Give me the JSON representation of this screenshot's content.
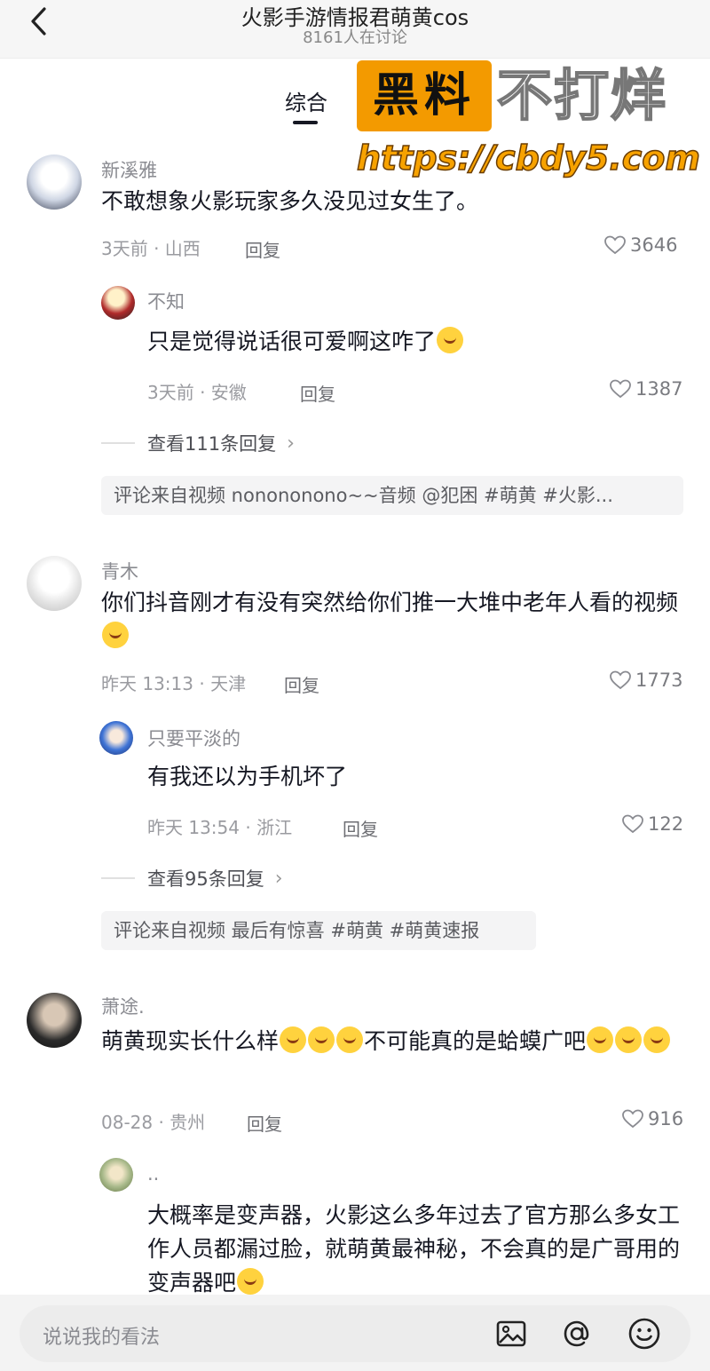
{
  "header": {
    "title": "火影手游情报君萌黄cos",
    "subtitle": "8161人在讨论"
  },
  "tab": {
    "label": "综合"
  },
  "watermark": {
    "box_text": "黑料",
    "text": "不打烊",
    "url": "https://cbdy5.com"
  },
  "comments": [
    {
      "name": "新溪雅",
      "text": "不敢想象火影玩家多久没见过女生了。",
      "meta": "3天前 · 山西",
      "reply_label": "回复",
      "likes": "3646",
      "sub": {
        "name": "不知",
        "text": "只是觉得说话很可爱啊这咋了",
        "meta": "3天前 · 安徽",
        "reply_label": "回复",
        "likes": "1387"
      },
      "more": "查看111条回复",
      "source": "评论来自视频 nonononono~~音频 @犯困 #萌黄 #火影..."
    },
    {
      "name": "青木",
      "text": "你们抖音刚才有没有突然给你们推一大堆中老年人看的视频",
      "meta": "昨天 13:13 · 天津",
      "reply_label": "回复",
      "likes": "1773",
      "sub": {
        "name": "只要平淡的",
        "text": "有我还以为手机坏了",
        "meta": "昨天 13:54 · 浙江",
        "reply_label": "回复",
        "likes": "122"
      },
      "more": "查看95条回复",
      "source": "评论来自视频 最后有惊喜 #萌黄 #萌黄速报"
    },
    {
      "name": "萧途.",
      "text_a": "萌黄现实长什么样",
      "text_b": "不可能真的是蛤蟆广吧",
      "meta": "08-28 · 贵州",
      "reply_label": "回复",
      "likes": "916",
      "sub": {
        "name": "..",
        "text": "大概率是变声器，火影这么多年过去了官方那么多女工作人员都漏过脸，就萌黄最神秘，不会真的是广哥用的变声器吧"
      }
    }
  ],
  "input": {
    "placeholder": "说说我的看法"
  },
  "icons": [
    "back-icon",
    "heart-icon",
    "chevron-right-icon",
    "image-icon",
    "at-icon",
    "emoji-icon"
  ],
  "colors": {
    "watermark_orange": "#f39a00",
    "text": "#161823",
    "muted": "#8a8b91"
  }
}
